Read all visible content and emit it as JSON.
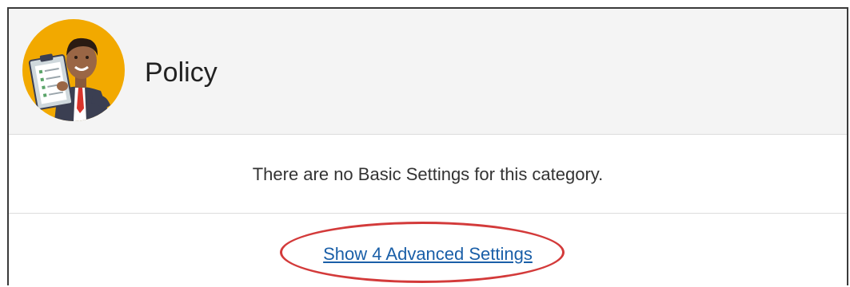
{
  "header": {
    "title": "Policy",
    "avatar_icon": "business-person-clipboard-avatar"
  },
  "basic": {
    "message": "There are no Basic Settings for this category."
  },
  "advanced": {
    "link_label": "Show 4 Advanced Settings"
  },
  "colors": {
    "accent_link": "#1a5fa8",
    "highlight": "#d33a3a",
    "avatar_bg": "#f2a900",
    "header_bg": "#f4f4f4"
  }
}
